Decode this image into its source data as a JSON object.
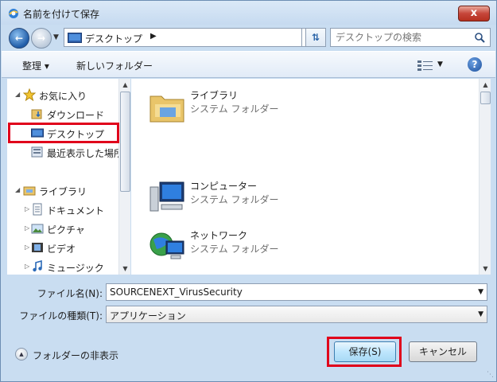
{
  "window": {
    "title": "名前を付けて保存",
    "close_label": "x"
  },
  "address": {
    "location": "デスクトップ",
    "search_placeholder": "デスクトップの検索"
  },
  "toolbar": {
    "organize_label": "整理 ▾",
    "new_folder_label": "新しいフォルダー"
  },
  "nav": {
    "favorites": "お気に入り",
    "downloads": "ダウンロード",
    "desktop": "デスクトップ",
    "recent": "最近表示した場所",
    "libraries": "ライブラリ",
    "documents": "ドキュメント",
    "pictures": "ピクチャ",
    "videos": "ビデオ",
    "music": "ミュージック"
  },
  "content": {
    "items": [
      {
        "name": "ライブラリ",
        "type": "システム フォルダー",
        "icon": "library-folder-icon"
      },
      {
        "name": "コンピューター",
        "type": "システム フォルダー",
        "icon": "computer-icon"
      },
      {
        "name": "ネットワーク",
        "type": "システム フォルダー",
        "icon": "network-icon"
      }
    ]
  },
  "form": {
    "filename_label": "ファイル名(N):",
    "filename_value": "SOURCENEXT_VirusSecurity",
    "filetype_label": "ファイルの種類(T):",
    "filetype_value": "アプリケーション"
  },
  "footer": {
    "hide_folders_label": "フォルダーの非表示",
    "save_label": "保存(S)",
    "cancel_label": "キャンセル"
  },
  "colors": {
    "highlight": "#e0001b",
    "frame": "#c9ddf1"
  }
}
